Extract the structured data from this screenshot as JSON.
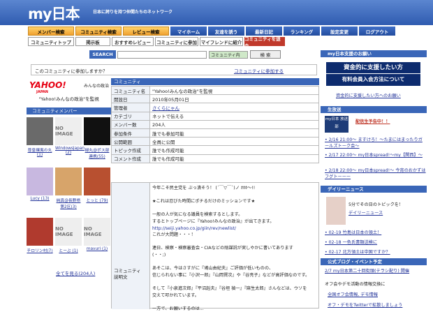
{
  "header": {
    "logo": "my日本",
    "tagline": "日本に誇りを持つ仲間たちのネットワーク"
  },
  "nav1": [
    {
      "label": "メンバー検索",
      "style": "o",
      "w": 66
    },
    {
      "label": "コミュニティ検索",
      "style": "o",
      "w": 66
    },
    {
      "label": "レビュー検索",
      "style": "o",
      "w": 66
    },
    {
      "label": "マイホーム",
      "style": "b",
      "w": 52
    },
    {
      "label": "友達を誘う",
      "style": "b",
      "w": 52
    },
    {
      "label": "最新日記",
      "style": "b",
      "w": 52
    },
    {
      "label": "ランキング",
      "style": "b",
      "w": 52
    },
    {
      "label": "設定変更",
      "style": "b",
      "w": 52
    },
    {
      "label": "ログアウト",
      "style": "b",
      "w": 52
    }
  ],
  "nav2": [
    {
      "label": "コミュニティトップ",
      "style": "w",
      "w": 66
    },
    {
      "label": "掲示板",
      "style": "w",
      "w": 50
    },
    {
      "label": "おすすめレビュー",
      "style": "w",
      "w": 60
    },
    {
      "label": "コミュニティに参加",
      "style": "w",
      "w": 62
    },
    {
      "label": "マイフレンドに紹介",
      "style": "w",
      "w": 62
    },
    {
      "label": "コミュニティを退会",
      "style": "r",
      "w": 58
    }
  ],
  "search": {
    "label": "SEARCH",
    "scope": "コミュニティ内",
    "button": "検 索"
  },
  "join": {
    "question": "このコミュニティに参加しますか？",
    "link": "コミュニティに参加する"
  },
  "left": {
    "yahoo": "YAHOO!",
    "yahoo_sub": "JAPAN",
    "yahoo_side": "みんなの政治",
    "community_name": "\"Yahoo!みんなの政治\"を監視",
    "member_head": "コミュニティメンバー",
    "all_members": "全てを見る(204人)",
    "members": [
      {
        "name": "尊皇攘夷の丸 (1)",
        "img": "ph1"
      },
      {
        "name": "WindowsJapan (2)",
        "img": "noimage"
      },
      {
        "name": "緑丸@ポス部連携(55)",
        "img": "ph3"
      },
      {
        "name": "Lucy (13)",
        "img": "ph4"
      },
      {
        "name": "純真@長野県第2区(3)",
        "img": "ph5"
      },
      {
        "name": "とっと (79)",
        "img": "ph6"
      },
      {
        "name": "チロリン村(7)",
        "img": "ph7"
      },
      {
        "name": "とーぶ (1)",
        "img": "noimage"
      },
      {
        "name": "mavuri (1)",
        "img": "noimage"
      }
    ],
    "noimage": "NO IMAGE"
  },
  "community": {
    "head": "コミュニティ",
    "rows": [
      {
        "k": "コミュニティ名",
        "v": "\"Yahoo!みんなの政治\"を監視"
      },
      {
        "k": "開設日",
        "v": "2010年05月01日"
      },
      {
        "k": "管理者",
        "v": "さくらにゃん",
        "link": true
      },
      {
        "k": "カテゴリ",
        "v": "ネットで伝える"
      },
      {
        "k": "メンバー数",
        "v": "204人"
      },
      {
        "k": "参加条件",
        "v": "誰でも参加可能"
      },
      {
        "k": "公開範囲",
        "v": "全員に公開"
      },
      {
        "k": "トピック作成",
        "v": "誰でも作成可能"
      },
      {
        "k": "コメント作成",
        "v": "誰でも作成可能"
      }
    ],
    "desc_label1": "コミュニティ",
    "desc_label2": "説明文",
    "desc": [
      "今年こそ民主党を ぶっ潰そう！ (´￣▽￣`)ノ ｵﾎﾎ〜!!",
      "",
      "★これは忍びた時間にポチるだけのミッションです★",
      "",
      "一般の人が気になる議員を検索するとします。",
      "するとトップページに『Yahoo!みんなの政治』が出てきます。",
      "http://seiji.yahoo.co.jp/giin/rev/newlist/",
      "これが大問題・・・！",
      "",
      "連日、検察・検察審査会・CIAなどの陰謀説が実しやかに書いてあります",
      "(・・;)",
      "",
      "あそこは、今はさすがに『鳩山由紀夫』ご評価が低いものの、",
      "信じられない事に『小沢一郎』『山岡賢次』や『谷亮子』などが高評価なのです。",
      "",
      "そして『小泉進次郎』『平沼赳夫』『谷垣 禎一』『麻生太郎』さんなどは、ウソを",
      "交えて叩かれています。",
      "",
      "一方で、お願いするのは..."
    ]
  },
  "right": {
    "h1": "my日本支援のお願い",
    "banner1": "資金的に支援したい方",
    "banner2": "有料会員入会方法について",
    "banner_link": "資金的に支援したい方へのお願い",
    "h2": "生放送",
    "live_title": "配信生予告中！！",
    "live_badge": "my日本 放送部",
    "live_items": [
      "2/16 21:00〜 ますけろ！〜たまにはまったりガールズトーク会〜",
      "2/17 22:00〜 my日本spread!〜my【関西】〜",
      "2/18 22:00〜 my日本spread!〜 今宵のおかずはフグトーーー"
    ],
    "h3": "デイリーニュース",
    "daily_title": "5分でその日のトピックを！",
    "daily_link": "デイリーニュース",
    "news": [
      "02-19 竹島は日本の領土！",
      "02-18 一色氏書類送検に",
      "02-17 北方領土は中国ですか？"
    ],
    "h4": "公式ブログ・イベント予定",
    "events": [
      "2/7 my日本第二十回街頭(テラシ配り) 開催"
    ],
    "offline": [
      "オフ会やデモ活動の情報交換に",
      "全国オフ会情報, デモ情報",
      "オフ・デモをTwitterで拡散しましょう"
    ]
  },
  "colors": {
    "accent": "#3a66b8",
    "header": "#2f5bb0",
    "tab_orange": "#f0a030",
    "tab_red": "#c0392b",
    "link": "#223399"
  }
}
